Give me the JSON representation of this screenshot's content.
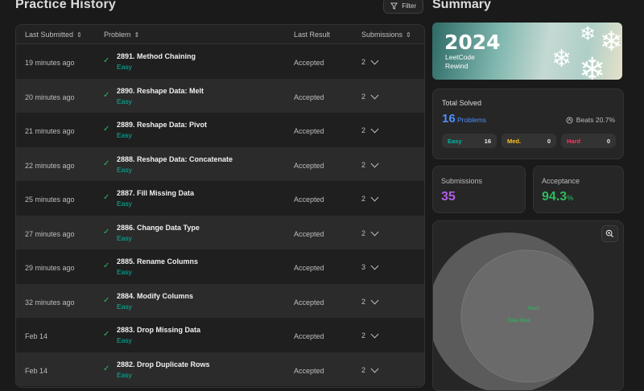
{
  "header": {
    "title": "Practice History",
    "filter_label": "Filter"
  },
  "table": {
    "columns": [
      "Last Submitted",
      "Problem",
      "Last Result",
      "Submissions"
    ],
    "rows": [
      {
        "date": "19 minutes ago",
        "problem": "2891. Method Chaining",
        "difficulty": "Easy",
        "result": "Accepted",
        "submissions": "2"
      },
      {
        "date": "20 minutes ago",
        "problem": "2890. Reshape Data: Melt",
        "difficulty": "Easy",
        "result": "Accepted",
        "submissions": "2"
      },
      {
        "date": "21 minutes ago",
        "problem": "2889. Reshape Data: Pivot",
        "difficulty": "Easy",
        "result": "Accepted",
        "submissions": "2"
      },
      {
        "date": "22 minutes ago",
        "problem": "2888. Reshape Data: Concatenate",
        "difficulty": "Easy",
        "result": "Accepted",
        "submissions": "2"
      },
      {
        "date": "25 minutes ago",
        "problem": "2887. Fill Missing Data",
        "difficulty": "Easy",
        "result": "Accepted",
        "submissions": "2"
      },
      {
        "date": "27 minutes ago",
        "problem": "2886. Change Data Type",
        "difficulty": "Easy",
        "result": "Accepted",
        "submissions": "2"
      },
      {
        "date": "29 minutes ago",
        "problem": "2885. Rename Columns",
        "difficulty": "Easy",
        "result": "Accepted",
        "submissions": "3"
      },
      {
        "date": "32 minutes ago",
        "problem": "2884. Modify Columns",
        "difficulty": "Easy",
        "result": "Accepted",
        "submissions": "2"
      },
      {
        "date": "Feb 14",
        "problem": "2883. Drop Missing Data",
        "difficulty": "Easy",
        "result": "Accepted",
        "submissions": "2"
      },
      {
        "date": "Feb 14",
        "problem": "2882. Drop Duplicate Rows",
        "difficulty": "Easy",
        "result": "Accepted",
        "submissions": "2"
      }
    ]
  },
  "summary": {
    "title": "Summary",
    "rewind": {
      "year": "2024",
      "line1": "LeetCode",
      "line2": "Rewind"
    },
    "total": {
      "title": "Total Solved",
      "count": "16",
      "unit": "Problems",
      "beats": "Beats 20.7%",
      "easy_label": "Easy",
      "easy_value": "16",
      "med_label": "Med.",
      "med_value": "0",
      "hard_label": "Hard",
      "hard_value": "0"
    },
    "submissions": {
      "title": "Submissions",
      "value": "35"
    },
    "acceptance": {
      "title": "Acceptance",
      "value": "94.3",
      "unit": "%"
    },
    "venn": {
      "label_a": "Hash",
      "label_b": "Data Mani"
    }
  },
  "colors": {
    "easy": "#00b8a3",
    "medium": "#ffc01e",
    "hard": "#ff375f",
    "accepted_check": "#2cbb5d",
    "solved_blue": "#4d8eff",
    "submissions_purple": "#b25de6"
  }
}
